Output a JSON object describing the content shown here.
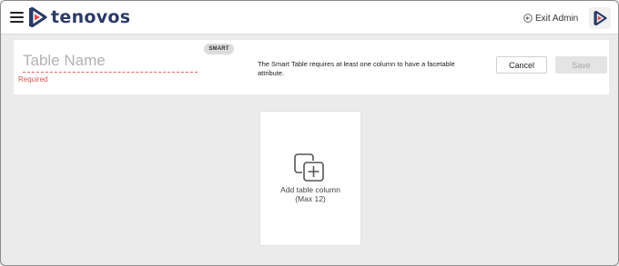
{
  "app": {
    "logo_text": "tenovos",
    "brand_color": "#2b3a67",
    "accent_color": "#e8474c"
  },
  "topbar": {
    "menu_icon": "hamburger-icon",
    "exit_label": "Exit Admin",
    "exit_icon": "exit-circle-icon",
    "brand_icon": "tenovos-play-icon"
  },
  "header": {
    "table_name_placeholder": "Table Name",
    "table_name_value": "",
    "required_text": "Required",
    "badge_label": "SMART",
    "notice_text": "The Smart Table requires at least one column to have a facetable attribute.",
    "cancel_label": "Cancel",
    "save_label": "Save",
    "save_disabled": true
  },
  "add_column": {
    "icon": "copy-add-icon",
    "label_line1": "Add table column",
    "label_line2": "(Max 12)"
  }
}
